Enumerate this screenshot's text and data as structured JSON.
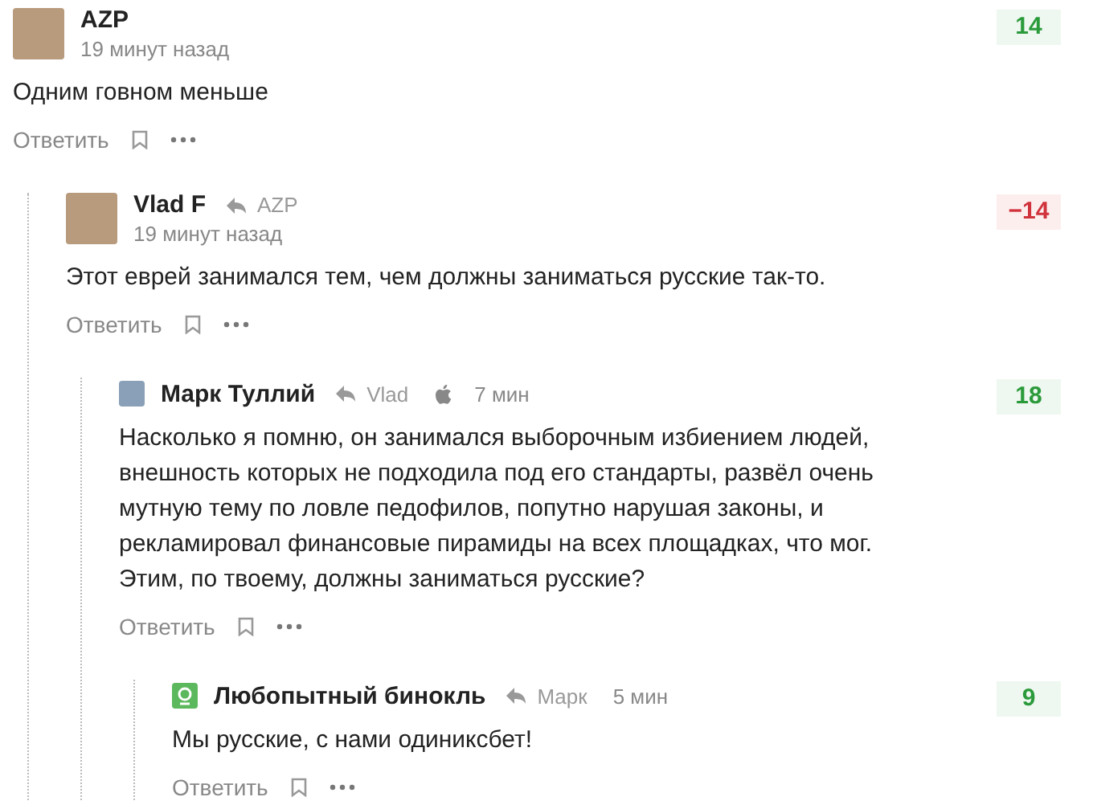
{
  "comments": [
    {
      "author": "AZP",
      "default_avatar": false,
      "apple_device": false,
      "time": "19 минут назад",
      "rating": "14",
      "rating_positive": true,
      "text": "Одним говном меньше",
      "reply_label": "Ответить",
      "children": [
        {
          "author": "Vlad F",
          "default_avatar": false,
          "reply_to": "AZP",
          "apple_device": false,
          "time": "19 минут назад",
          "rating": "−14",
          "rating_positive": false,
          "text": "Этот еврей занимался тем, чем должны заниматься русские так-то.",
          "reply_label": "Ответить",
          "children": [
            {
              "author": "Марк Туллий",
              "default_avatar": false,
              "reply_to": "Vlad",
              "apple_device": true,
              "time": "7 мин",
              "rating": "18",
              "rating_positive": true,
              "text": "Насколько я помню, он занимался выборочным избиением людей, внешность которых не подходила под его стандарты, развёл очень мутную тему по ловле педофилов, попутно нарушая законы, и рекламировал финансовые пирамиды на всех площадках, что мог. Этим, по твоему, должны заниматься русские?",
              "reply_label": "Ответить",
              "children": [
                {
                  "author": "Любопытный бинокль",
                  "default_avatar": true,
                  "reply_to": "Марк",
                  "apple_device": false,
                  "time": "5 мин",
                  "rating": "9",
                  "rating_positive": true,
                  "text": "Мы русские, с нами одиниксбет!",
                  "reply_label": "Ответить"
                }
              ]
            }
          ]
        }
      ]
    }
  ]
}
